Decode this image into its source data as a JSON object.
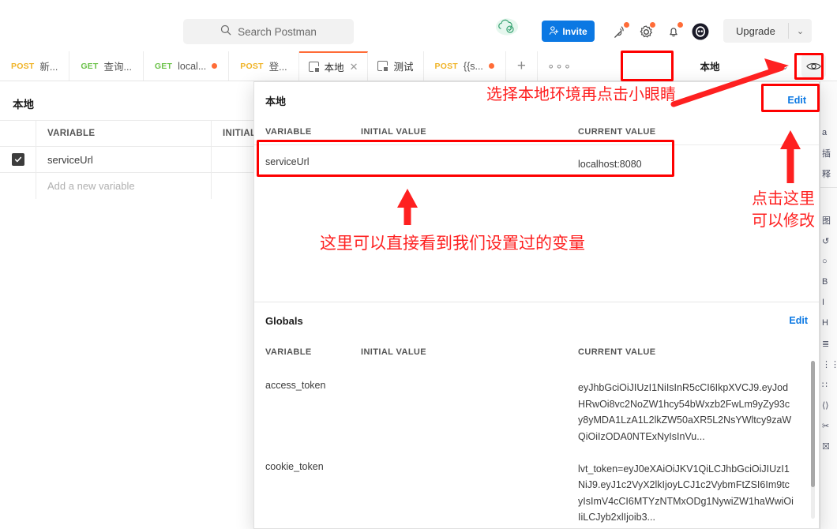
{
  "header": {
    "search_placeholder": "Search Postman",
    "search_icon": "search-icon",
    "cloud_icon": "cloud-check-icon",
    "invite_label": "Invite",
    "invite_icon": "person-add-icon",
    "icons": [
      {
        "name": "satellite-icon",
        "badge": true
      },
      {
        "name": "gear-icon",
        "badge": true
      },
      {
        "name": "bell-icon",
        "badge": true
      },
      {
        "name": "avatar-icon",
        "badge": false
      }
    ],
    "upgrade_label": "Upgrade",
    "upgrade_caret": "⌄",
    "accent_color": "#ff6c37",
    "invite_color": "#0b78e3"
  },
  "tabs": {
    "request_tabs": [
      {
        "method": "POST",
        "name": "新...",
        "method_color": "#f0b429",
        "unsaved": false
      },
      {
        "method": "GET",
        "name": "查询...",
        "method_color": "#6cc24a",
        "unsaved": false
      },
      {
        "method": "GET",
        "name": "local...",
        "method_color": "#6cc24a",
        "unsaved": true
      },
      {
        "method": "POST",
        "name": "登...",
        "method_color": "#f0b429",
        "unsaved": false
      }
    ],
    "env_tabs": [
      {
        "name": "本地",
        "active": true,
        "closable": true
      },
      {
        "name": "测试",
        "active": false,
        "closable": false
      }
    ],
    "trailing_tab": {
      "method": "POST",
      "name": "{{s...",
      "method_color": "#f0b429",
      "unsaved": true
    },
    "new_tab_icon": "plus-icon",
    "more_tabs_icon": "ellipsis-icon"
  },
  "env_selector": {
    "label": "本地",
    "caret": "⌄",
    "eye_icon": "eye-icon"
  },
  "background_editor": {
    "title": "本地",
    "columns": [
      "VARIABLE",
      "INITIAL"
    ],
    "rows": [
      {
        "checked": true,
        "variable": "serviceUrl",
        "initial": ""
      }
    ],
    "add_row_placeholder": "Add a new variable"
  },
  "popup": {
    "environment": {
      "name": "本地",
      "edit_label": "Edit",
      "columns": {
        "variable": "VARIABLE",
        "initial": "INITIAL VALUE",
        "current": "CURRENT VALUE"
      },
      "rows": [
        {
          "variable": "serviceUrl",
          "initial": "",
          "current": "localhost:8080"
        }
      ]
    },
    "globals": {
      "name": "Globals",
      "edit_label": "Edit",
      "columns": {
        "variable": "VARIABLE",
        "initial": "INITIAL VALUE",
        "current": "CURRENT VALUE"
      },
      "rows": [
        {
          "variable": "access_token",
          "initial": "",
          "current": "eyJhbGciOiJIUzI1NiIsInR5cCI6IkpXVCJ9.eyJodHRwOi8vc2NoZW1hcy54bWxzb2FwLm9yZy93cy8yMDA1LzA1L2lkZW50aXR5L2NsYWltcy9zaWQiOiIzODA0NTExNyIsInVu..."
        },
        {
          "variable": "cookie_token",
          "initial": "",
          "current": "lvt_token=eyJ0eXAiOiJKV1QiLCJhbGciOiJIUzI1NiJ9.eyJ1c2VyX2lkIjoyLCJ1c2VybmFtZSI6Im9tcyIsImV4cCI6MTYzNTMxODg1NywiZW1haWwiOiIiLCJyb2xlIjoib3..."
        }
      ]
    }
  },
  "annotations": {
    "top_note": "选择本地环境再点击小眼睛",
    "bottom_note": "这里可以直接看到我们设置过的变量",
    "right_note_line1": "点击这里",
    "right_note_line2": "可以修改",
    "color": "#fe2020"
  },
  "right_rail": {
    "items": [
      "a",
      "插",
      "释",
      "图",
      "↺",
      "○",
      "B",
      "Ι",
      "H",
      "≣",
      "⋮⋮",
      "∷",
      "⟨⟩",
      "✂",
      "☒"
    ]
  }
}
